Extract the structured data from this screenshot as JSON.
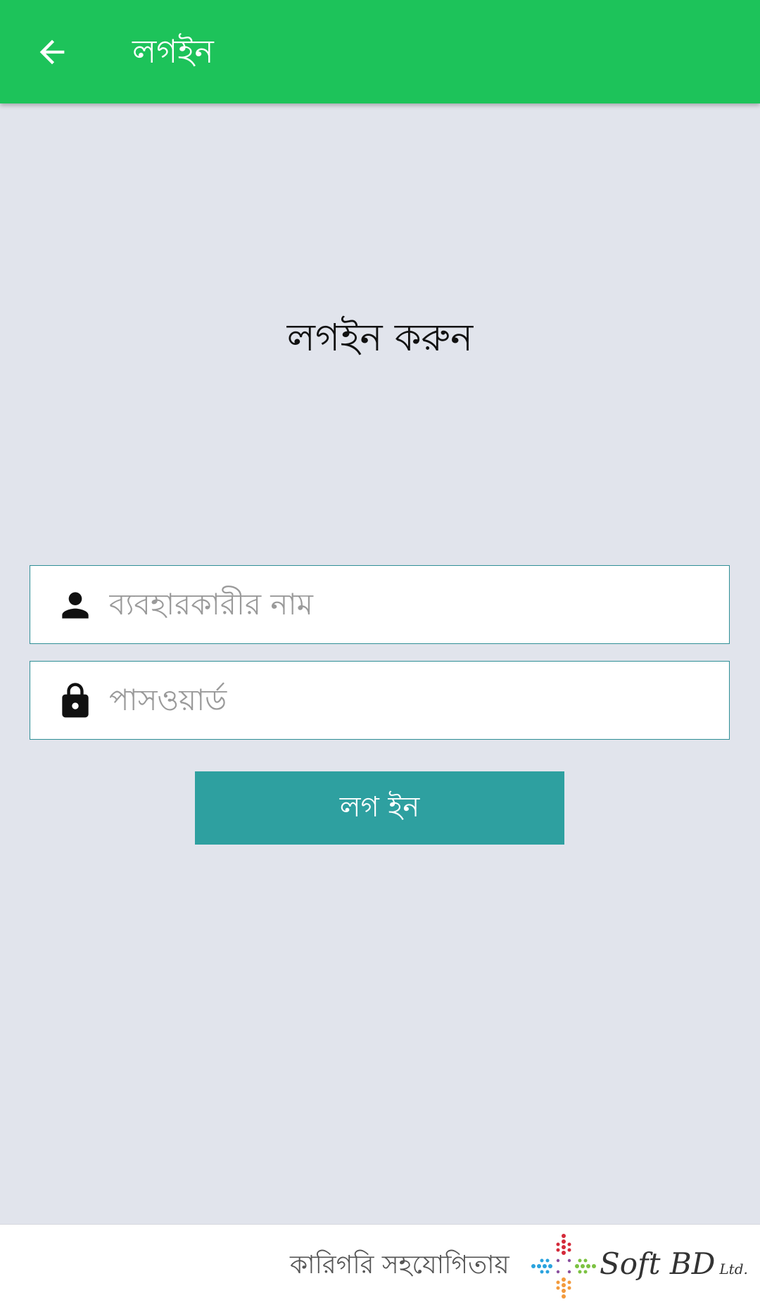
{
  "app_bar": {
    "title": "লগইন",
    "back_icon": "arrow-left-icon",
    "background_color": "#1dc35a"
  },
  "main": {
    "heading": "লগইন করুন",
    "username": {
      "icon": "person-icon",
      "value": "",
      "placeholder": "ব্যবহারকারীর নাম"
    },
    "password": {
      "icon": "lock-icon",
      "value": "",
      "placeholder": "পাসওয়ার্ড"
    },
    "login_button": {
      "label": "লগ ইন",
      "color": "#2ea0a0"
    }
  },
  "footer": {
    "text": "কারিগরি সহযোগিতায়",
    "brand": {
      "name": "Soft BD",
      "suffix": "Ltd.",
      "logo_icon": "softbd-logo-icon"
    }
  }
}
